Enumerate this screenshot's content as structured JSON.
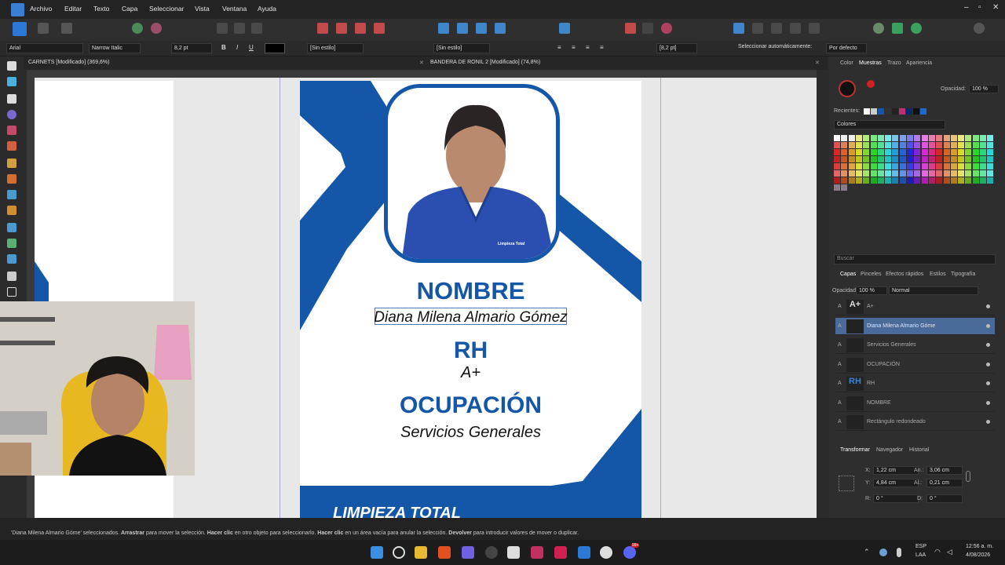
{
  "menubar": {
    "items": [
      "Archivo",
      "Editar",
      "Texto",
      "Capa",
      "Seleccionar",
      "Vista",
      "Ventana",
      "Ayuda"
    ],
    "window_controls": [
      "–",
      "▫",
      "✕"
    ]
  },
  "context_bar": {
    "font_family": "Arial",
    "font_style": "Narrow Italic",
    "font_size": "8,2 pt",
    "bold": "B",
    "italic": "I",
    "underline": "U",
    "char_style": "[Sin estilo]",
    "para_style": "[Sin estilo]",
    "leading": "[8,2 pt]",
    "auto_select": "Seleccionar automáticamente:",
    "auto_select_mode": "Por defecto"
  },
  "tabs": [
    {
      "label": "CARNETS [Modificado] (369,6%)"
    },
    {
      "label": "BANDERA DE RONIL 2 [Modificado] (74,8%)"
    }
  ],
  "card": {
    "heading_name": "NOMBRE",
    "name_value": "Diana Milena Almario Gómez",
    "heading_rh": "RH",
    "rh_value": "A+",
    "heading_occupation": "OCUPACIÓN",
    "occupation_value": "Servicios Generales",
    "footer_brand": "LIMPIEZA TOTAL",
    "shirt_logo": "Limpieza Total"
  },
  "right_panel": {
    "top_tabs": [
      "Color",
      "Muestras",
      "Trazo",
      "Apariencia"
    ],
    "opacity_label": "Opacidad:",
    "opacity_value": "100 %",
    "recent_label": "Recientes:",
    "palette_name": "Colores",
    "search_placeholder": "Buscar",
    "layer_tabs": [
      "Capas",
      "Pinceles",
      "Efectos rápidos",
      "Estilos",
      "Tipografía"
    ],
    "layers_opacity_label": "Opacidad:",
    "layers_opacity_value": "100 %",
    "blend_mode": "Normal",
    "layers": [
      {
        "name": "A+",
        "thumb": "A+"
      },
      {
        "name": "Diana Milena Almario Góme",
        "thumb": ""
      },
      {
        "name": "Servicios Generales",
        "thumb": ""
      },
      {
        "name": "OCUPACIÓN",
        "thumb": ""
      },
      {
        "name": "RH",
        "thumb": "RH"
      },
      {
        "name": "NOMBRE",
        "thumb": ""
      },
      {
        "name": "Rectángulo redondeado",
        "thumb": ""
      }
    ],
    "transform_tabs": [
      "Transformar",
      "Navegador",
      "Historial"
    ],
    "transform": {
      "x_label": "X:",
      "x": "1,22 cm",
      "y_label": "Y:",
      "y": "4,84 cm",
      "w_label": "An.:",
      "w": "3,06 cm",
      "h_label": "Al.:",
      "h": "0,21 cm",
      "r_label": "R:",
      "r": "0 °",
      "s_label": "D:",
      "s": "0 °"
    }
  },
  "status_bar": {
    "sel_name": "'Diana Milena Almario Góme' seleccionados.",
    "drag_bold": "Arrastrar",
    "drag_text": "para mover la selección.",
    "click_bold": "Hacer clic",
    "click_text": "en otro objeto para seleccionarlo.",
    "click_empty_bold": "Hacer clic",
    "click_empty_text": "en un área vacía para anular la selección.",
    "return_bold": "Devolver",
    "return_text": "para introducir valores de mover o duplicar."
  },
  "taskbar": {
    "lang_line1": "ESP",
    "lang_line2": "LAA",
    "time": "12:56 a. m.",
    "date": "4/08/2026",
    "badge": "99+"
  },
  "colors": {
    "brand_blue": "#1456a8",
    "selection_blue": "#4a7bb7",
    "panel_bg": "#2e2e2e"
  }
}
